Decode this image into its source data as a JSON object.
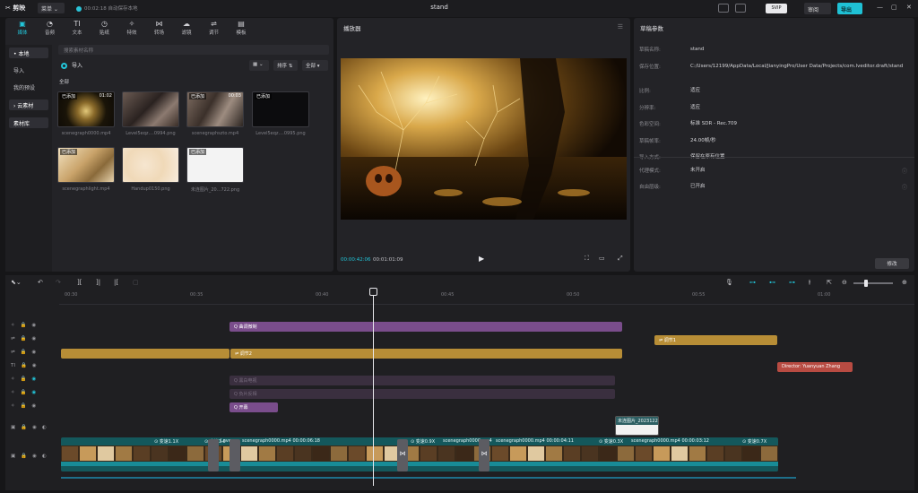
{
  "app": {
    "logo": "✂ 剪映",
    "menu": "菜单 ⌄",
    "autosave": "00:02:18 自动保存本地",
    "title": "stand",
    "sub_badge": "SVIP",
    "review": "审阅",
    "export": "导出"
  },
  "media": {
    "tabs": [
      {
        "label": "媒体",
        "icon": "▣",
        "active": true
      },
      {
        "label": "音频",
        "icon": "◔"
      },
      {
        "label": "文本",
        "icon": "TI"
      },
      {
        "label": "贴纸",
        "icon": "◷"
      },
      {
        "label": "特效",
        "icon": "✧"
      },
      {
        "label": "转场",
        "icon": "⋈"
      },
      {
        "label": "滤镜",
        "icon": "☁"
      },
      {
        "label": "调节",
        "icon": "⇌"
      },
      {
        "label": "模板",
        "icon": "▤"
      }
    ],
    "side": [
      {
        "label": "• 本地",
        "active": true
      },
      {
        "label": "导入"
      },
      {
        "label": "我的预设"
      },
      {
        "label": "› 云素材"
      },
      {
        "label": "素材库"
      }
    ],
    "search_placeholder": "搜索素材名称",
    "import_label": "导入",
    "sort_label": "排序 ⇅",
    "filter_label": "全部 ▾",
    "view_label": "▦ ⌄",
    "section": "全部",
    "items": [
      {
        "badge": "已添加",
        "duration": "01:02",
        "label": "scenegraph0000.mp4"
      },
      {
        "badge": "",
        "duration": "",
        "label": "Level5eqz....0994.png"
      },
      {
        "badge": "已添加",
        "duration": "00:03",
        "label": "scenegraphszto.mp4"
      },
      {
        "badge": "已添加",
        "duration": "",
        "label": "Level5eqz....0995.png"
      },
      {
        "badge": "已添加",
        "duration": "",
        "label": "scenegraphlight.mp4"
      },
      {
        "badge": "",
        "duration": "",
        "label": "Handup0150.png"
      },
      {
        "badge": "已添加",
        "duration": "",
        "label": "未连图片_20...722.png"
      }
    ]
  },
  "player": {
    "title": "播放器",
    "time_current": "00:00:42:06",
    "time_total": "00:01:01:09"
  },
  "draft": {
    "title": "草稿参数",
    "props": [
      {
        "k": "草稿名称:",
        "v": "stand"
      },
      {
        "k": "保存位置:",
        "v": "C:/Users/12199/AppData/Local/JianyingPro/User Data/Projects/com.lveditor.draft/stand"
      },
      {
        "k": "比例:",
        "v": "适应"
      },
      {
        "k": "分辨率:",
        "v": "适应"
      },
      {
        "k": "色彩空间:",
        "v": "标准 SDR - Rec.709"
      },
      {
        "k": "草稿帧率:",
        "v": "24.00帧/秒"
      },
      {
        "k": "导入方式:",
        "v": "保留在原有位置"
      }
    ],
    "props2": [
      {
        "k": "代理模式:",
        "v": "未开启"
      },
      {
        "k": "自由层级:",
        "v": "已开启"
      }
    ],
    "edit_label": "修改"
  },
  "timeline": {
    "ruler": [
      "00:30",
      "00:35",
      "00:40",
      "00:45",
      "00:50",
      "00:55",
      "01:00"
    ],
    "clips": {
      "effect_top": "Q 曲调微制",
      "adjust1": "⇌ 调节1",
      "adjust2": "⇌ 调节2",
      "text_red": "Director: Yuanyuan Zhang",
      "ghost1": "Q 黑白电视",
      "ghost2": "Q 负片反相",
      "open": "Q 开幕",
      "sticker": "未连图片_2023122"
    },
    "segments": [
      "⊙ 变速1.1X",
      "⊙ 变速1.0",
      "Leve",
      "scenegraph0000.mp4  00:00:06:18",
      "⊙ 变速0.9X",
      "scenegraph0000.mp4",
      "scenegraph0000.mp4  00:00:04:11",
      "⊙ 变速0.3X",
      "scenegraph0000.mp4  00:00:03:12",
      "⊙ 变速0.7X"
    ]
  }
}
